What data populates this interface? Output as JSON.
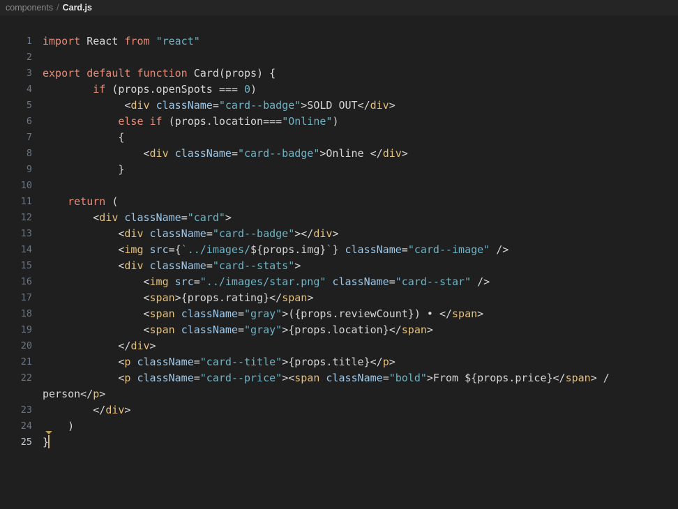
{
  "breadcrumb": {
    "folder": "components",
    "separator": "/",
    "file": "Card.js"
  },
  "colors": {
    "background": "#1f1f1f",
    "breadcrumb_background": "#252526",
    "keyword": "#e88b77",
    "string": "#6fb3c4",
    "jsx_tag": "#e5c07b",
    "jsx_attribute": "#9cc7e8",
    "plain_text": "#d6d6d6",
    "line_number": "#6b7785",
    "line_number_active": "#c8ccd2",
    "cursor": "#c8b37a"
  },
  "editor": {
    "active_line": 25,
    "cursor_line": 25,
    "cursor_column": 2,
    "line_numbers": [
      "1",
      "2",
      "3",
      "4",
      "5",
      "6",
      "7",
      "8",
      "9",
      "10",
      "11",
      "12",
      "13",
      "14",
      "15",
      "16",
      "17",
      "18",
      "19",
      "20",
      "21",
      "22",
      "23",
      "24",
      "25"
    ],
    "lines": [
      {
        "number": "1",
        "wrapped": false,
        "tokens": [
          {
            "text": "import",
            "type": "keyword"
          },
          {
            "text": " React ",
            "type": "plain"
          },
          {
            "text": "from",
            "type": "keyword"
          },
          {
            "text": " ",
            "type": "plain"
          },
          {
            "text": "\"react\"",
            "type": "string"
          }
        ]
      },
      {
        "number": "2",
        "wrapped": false,
        "tokens": []
      },
      {
        "number": "3",
        "wrapped": false,
        "tokens": [
          {
            "text": "export default function",
            "type": "keyword"
          },
          {
            "text": " Card(props) {",
            "type": "plain"
          }
        ]
      },
      {
        "number": "4",
        "wrapped": false,
        "tokens": [
          {
            "text": "        ",
            "type": "plain"
          },
          {
            "text": "if",
            "type": "keyword"
          },
          {
            "text": " (props.openSpots === ",
            "type": "plain"
          },
          {
            "text": "0",
            "type": "number"
          },
          {
            "text": ")",
            "type": "plain"
          }
        ]
      },
      {
        "number": "5",
        "wrapped": false,
        "tokens": [
          {
            "text": "             <",
            "type": "plain"
          },
          {
            "text": "div",
            "type": "jsx_tag"
          },
          {
            "text": " ",
            "type": "plain"
          },
          {
            "text": "className",
            "type": "jsx_attribute"
          },
          {
            "text": "=",
            "type": "plain"
          },
          {
            "text": "\"card--badge\"",
            "type": "string"
          },
          {
            "text": ">SOLD OUT</",
            "type": "plain"
          },
          {
            "text": "div",
            "type": "jsx_tag"
          },
          {
            "text": ">",
            "type": "plain"
          }
        ]
      },
      {
        "number": "6",
        "wrapped": false,
        "tokens": [
          {
            "text": "            ",
            "type": "plain"
          },
          {
            "text": "else if",
            "type": "keyword"
          },
          {
            "text": " (props.location===",
            "type": "plain"
          },
          {
            "text": "\"Online\"",
            "type": "string"
          },
          {
            "text": ")",
            "type": "plain"
          }
        ]
      },
      {
        "number": "7",
        "wrapped": false,
        "tokens": [
          {
            "text": "            {",
            "type": "plain"
          }
        ]
      },
      {
        "number": "8",
        "wrapped": false,
        "tokens": [
          {
            "text": "                <",
            "type": "plain"
          },
          {
            "text": "div",
            "type": "jsx_tag"
          },
          {
            "text": " ",
            "type": "plain"
          },
          {
            "text": "className",
            "type": "jsx_attribute"
          },
          {
            "text": "=",
            "type": "plain"
          },
          {
            "text": "\"card--badge\"",
            "type": "string"
          },
          {
            "text": ">Online </",
            "type": "plain"
          },
          {
            "text": "div",
            "type": "jsx_tag"
          },
          {
            "text": ">",
            "type": "plain"
          }
        ]
      },
      {
        "number": "9",
        "wrapped": false,
        "tokens": [
          {
            "text": "            }",
            "type": "plain"
          }
        ]
      },
      {
        "number": "10",
        "wrapped": false,
        "tokens": []
      },
      {
        "number": "11",
        "wrapped": false,
        "tokens": [
          {
            "text": "    ",
            "type": "plain"
          },
          {
            "text": "return",
            "type": "keyword"
          },
          {
            "text": " (",
            "type": "plain"
          }
        ]
      },
      {
        "number": "12",
        "wrapped": false,
        "tokens": [
          {
            "text": "        <",
            "type": "plain"
          },
          {
            "text": "div",
            "type": "jsx_tag"
          },
          {
            "text": " ",
            "type": "plain"
          },
          {
            "text": "className",
            "type": "jsx_attribute"
          },
          {
            "text": "=",
            "type": "plain"
          },
          {
            "text": "\"card\"",
            "type": "string"
          },
          {
            "text": ">",
            "type": "plain"
          }
        ]
      },
      {
        "number": "13",
        "wrapped": false,
        "tokens": [
          {
            "text": "            <",
            "type": "plain"
          },
          {
            "text": "div",
            "type": "jsx_tag"
          },
          {
            "text": " ",
            "type": "plain"
          },
          {
            "text": "className",
            "type": "jsx_attribute"
          },
          {
            "text": "=",
            "type": "plain"
          },
          {
            "text": "\"card--badge\"",
            "type": "string"
          },
          {
            "text": "></",
            "type": "plain"
          },
          {
            "text": "div",
            "type": "jsx_tag"
          },
          {
            "text": ">",
            "type": "plain"
          }
        ]
      },
      {
        "number": "14",
        "wrapped": false,
        "tokens": [
          {
            "text": "            <",
            "type": "plain"
          },
          {
            "text": "img",
            "type": "jsx_tag"
          },
          {
            "text": " ",
            "type": "plain"
          },
          {
            "text": "src",
            "type": "jsx_attribute"
          },
          {
            "text": "={",
            "type": "plain"
          },
          {
            "text": "`../images/",
            "type": "string"
          },
          {
            "text": "${props.img}",
            "type": "plain"
          },
          {
            "text": "`",
            "type": "string"
          },
          {
            "text": "} ",
            "type": "plain"
          },
          {
            "text": "className",
            "type": "jsx_attribute"
          },
          {
            "text": "=",
            "type": "plain"
          },
          {
            "text": "\"card--image\"",
            "type": "string"
          },
          {
            "text": " />",
            "type": "plain"
          }
        ]
      },
      {
        "number": "15",
        "wrapped": false,
        "tokens": [
          {
            "text": "            <",
            "type": "plain"
          },
          {
            "text": "div",
            "type": "jsx_tag"
          },
          {
            "text": " ",
            "type": "plain"
          },
          {
            "text": "className",
            "type": "jsx_attribute"
          },
          {
            "text": "=",
            "type": "plain"
          },
          {
            "text": "\"card--stats\"",
            "type": "string"
          },
          {
            "text": ">",
            "type": "plain"
          }
        ]
      },
      {
        "number": "16",
        "wrapped": false,
        "tokens": [
          {
            "text": "                <",
            "type": "plain"
          },
          {
            "text": "img",
            "type": "jsx_tag"
          },
          {
            "text": " ",
            "type": "plain"
          },
          {
            "text": "src",
            "type": "jsx_attribute"
          },
          {
            "text": "=",
            "type": "plain"
          },
          {
            "text": "\"../images/star.png\"",
            "type": "string"
          },
          {
            "text": " ",
            "type": "plain"
          },
          {
            "text": "className",
            "type": "jsx_attribute"
          },
          {
            "text": "=",
            "type": "plain"
          },
          {
            "text": "\"card--star\"",
            "type": "string"
          },
          {
            "text": " />",
            "type": "plain"
          }
        ]
      },
      {
        "number": "17",
        "wrapped": false,
        "tokens": [
          {
            "text": "                <",
            "type": "plain"
          },
          {
            "text": "span",
            "type": "jsx_tag"
          },
          {
            "text": ">{props.rating}</",
            "type": "plain"
          },
          {
            "text": "span",
            "type": "jsx_tag"
          },
          {
            "text": ">",
            "type": "plain"
          }
        ]
      },
      {
        "number": "18",
        "wrapped": false,
        "tokens": [
          {
            "text": "                <",
            "type": "plain"
          },
          {
            "text": "span",
            "type": "jsx_tag"
          },
          {
            "text": " ",
            "type": "plain"
          },
          {
            "text": "className",
            "type": "jsx_attribute"
          },
          {
            "text": "=",
            "type": "plain"
          },
          {
            "text": "\"gray\"",
            "type": "string"
          },
          {
            "text": ">({props.reviewCount}) • </",
            "type": "plain"
          },
          {
            "text": "span",
            "type": "jsx_tag"
          },
          {
            "text": ">",
            "type": "plain"
          }
        ]
      },
      {
        "number": "19",
        "wrapped": false,
        "tokens": [
          {
            "text": "                <",
            "type": "plain"
          },
          {
            "text": "span",
            "type": "jsx_tag"
          },
          {
            "text": " ",
            "type": "plain"
          },
          {
            "text": "className",
            "type": "jsx_attribute"
          },
          {
            "text": "=",
            "type": "plain"
          },
          {
            "text": "\"gray\"",
            "type": "string"
          },
          {
            "text": ">{props.location}</",
            "type": "plain"
          },
          {
            "text": "span",
            "type": "jsx_tag"
          },
          {
            "text": ">",
            "type": "plain"
          }
        ]
      },
      {
        "number": "20",
        "wrapped": false,
        "tokens": [
          {
            "text": "            </",
            "type": "plain"
          },
          {
            "text": "div",
            "type": "jsx_tag"
          },
          {
            "text": ">",
            "type": "plain"
          }
        ]
      },
      {
        "number": "21",
        "wrapped": false,
        "tokens": [
          {
            "text": "            <",
            "type": "plain"
          },
          {
            "text": "p",
            "type": "jsx_tag"
          },
          {
            "text": " ",
            "type": "plain"
          },
          {
            "text": "className",
            "type": "jsx_attribute"
          },
          {
            "text": "=",
            "type": "plain"
          },
          {
            "text": "\"card--title\"",
            "type": "string"
          },
          {
            "text": ">{props.title}</",
            "type": "plain"
          },
          {
            "text": "p",
            "type": "jsx_tag"
          },
          {
            "text": ">",
            "type": "plain"
          }
        ]
      },
      {
        "number": "22",
        "wrapped": true,
        "tokens": [
          {
            "text": "            <",
            "type": "plain"
          },
          {
            "text": "p",
            "type": "jsx_tag"
          },
          {
            "text": " ",
            "type": "plain"
          },
          {
            "text": "className",
            "type": "jsx_attribute"
          },
          {
            "text": "=",
            "type": "plain"
          },
          {
            "text": "\"card--price\"",
            "type": "string"
          },
          {
            "text": "><",
            "type": "plain"
          },
          {
            "text": "span",
            "type": "jsx_tag"
          },
          {
            "text": " ",
            "type": "plain"
          },
          {
            "text": "className",
            "type": "jsx_attribute"
          },
          {
            "text": "=",
            "type": "plain"
          },
          {
            "text": "\"bold\"",
            "type": "string"
          },
          {
            "text": ">From ${props.price}</",
            "type": "plain"
          },
          {
            "text": "span",
            "type": "jsx_tag"
          },
          {
            "text": "> / person</",
            "type": "plain"
          },
          {
            "text": "p",
            "type": "jsx_tag"
          },
          {
            "text": ">",
            "type": "plain"
          }
        ]
      },
      {
        "number": "23",
        "wrapped": false,
        "tokens": [
          {
            "text": "        </",
            "type": "plain"
          },
          {
            "text": "div",
            "type": "jsx_tag"
          },
          {
            "text": ">",
            "type": "plain"
          }
        ]
      },
      {
        "number": "24",
        "wrapped": false,
        "tokens": [
          {
            "text": "    )",
            "type": "plain"
          }
        ]
      },
      {
        "number": "25",
        "wrapped": false,
        "cursor_after": true,
        "tokens": [
          {
            "text": "}",
            "type": "plain"
          }
        ]
      }
    ]
  }
}
